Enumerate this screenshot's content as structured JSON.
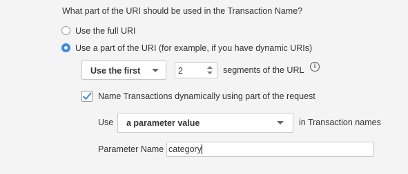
{
  "question": "What part of the URI should be used in the Transaction Name?",
  "uri_options": [
    {
      "label": "Use the full URI",
      "selected": false
    },
    {
      "label": "Use a part of the URI (for example, if you have dynamic URIs)",
      "selected": true
    }
  ],
  "segment": {
    "mode_value": "Use the first",
    "count_value": "2",
    "suffix": "segments of the URL",
    "info_glyph": "i"
  },
  "dynamic": {
    "checked": true,
    "label": "Name Transactions dynamically using part of the request",
    "use_label": "Use",
    "source_value": "a parameter value",
    "in_label": "in Transaction names",
    "param_label": "Parameter Name",
    "param_value": "category"
  },
  "colors": {
    "accent": "#3b8ce3",
    "background": "#f4f4f4"
  }
}
